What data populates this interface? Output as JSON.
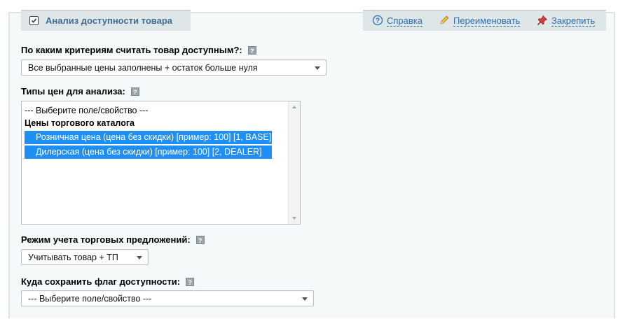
{
  "section": {
    "title": "Анализ доступности товара",
    "actions": [
      {
        "label": "Справка",
        "icon": "help-circle-icon"
      },
      {
        "label": "Переименовать",
        "icon": "pencil-icon"
      },
      {
        "label": "Закрепить",
        "icon": "pin-icon"
      }
    ]
  },
  "criteria": {
    "label": "По каким критериям считать товар доступным?:",
    "value": "Все выбранные цены заполнены + остаток больше нуля"
  },
  "price_types": {
    "label": "Типы цен для анализа:",
    "options": [
      {
        "text": "--- Выберите поле/свойство ---",
        "selected": false
      },
      {
        "text": "Цены торгового каталога",
        "group": true
      },
      {
        "text": "Розничная цена (цена без скидки) [пример: 100] [1, BASE]",
        "selected": true
      },
      {
        "text": "Дилерская (цена без скидки) [пример: 100] [2, DEALER]",
        "selected": true
      }
    ]
  },
  "offers_mode": {
    "label": "Режим учета торговых предложений:",
    "value": "Учитывать товар + ТП"
  },
  "flag_target": {
    "label": "Куда сохранить флаг доступности:",
    "value": "--- Выберите поле/свойство ---"
  },
  "help_glyph": "?"
}
